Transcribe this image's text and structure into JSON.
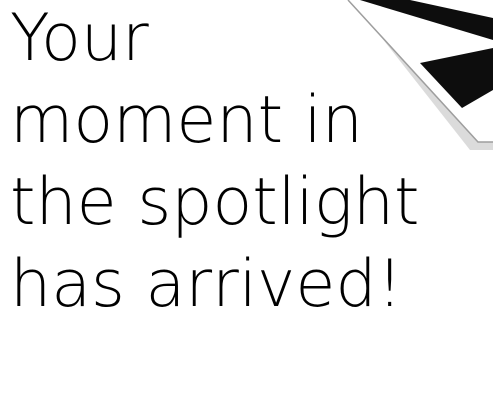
{
  "headline": {
    "lines": [
      "Your",
      "moment in",
      "the spotlight",
      "has arrived!"
    ]
  },
  "decoration": {
    "name": "clapperboard-stripe-icon",
    "colors": {
      "stripe_dark": "#0d0d0d",
      "stripe_light": "#ffffff",
      "shadow": "#bdbdbd"
    }
  }
}
